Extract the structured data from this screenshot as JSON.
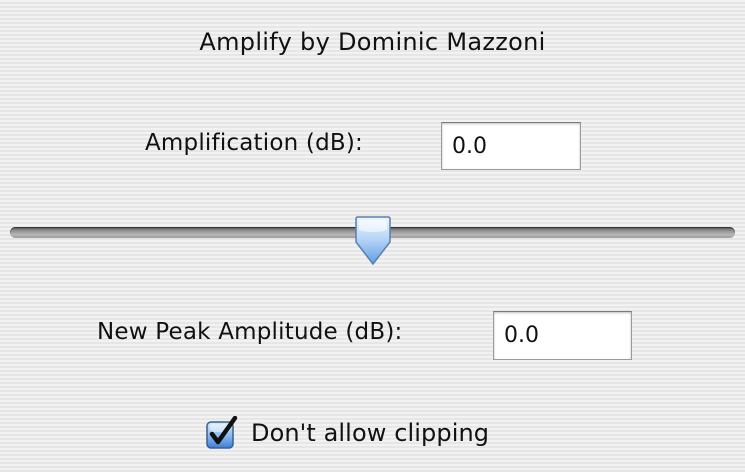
{
  "dialog": {
    "title": "Amplify by Dominic Mazzoni"
  },
  "amplification": {
    "label": "Amplification (dB):",
    "value": "0.0"
  },
  "slider": {
    "position_fraction": 0.5
  },
  "peak": {
    "label": "New Peak Amplitude (dB):",
    "value": "0.0"
  },
  "clipping": {
    "label": "Don't allow clipping",
    "checked": true
  },
  "colors": {
    "accent": "#3d7fd6",
    "thumb_light": "#d6e8fb",
    "track_dark": "#555555"
  }
}
